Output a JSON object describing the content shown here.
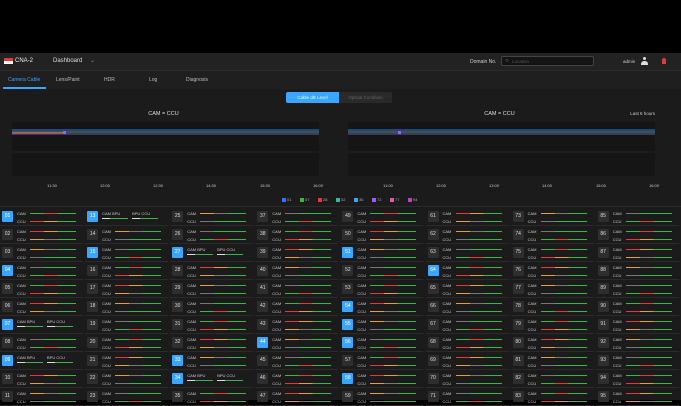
{
  "header": {
    "logo_text": "CNA",
    "app_title": "CNA-2",
    "section": "Dashboard",
    "domain_label": "Domain No.",
    "search_placeholder": "Location",
    "user": "admin",
    "colors": {
      "accent": "#3aa6ff",
      "brand": "#e23a3a"
    }
  },
  "tabs": [
    "Camera Cable",
    "Lens/Paint",
    "HDR",
    "Log",
    "Diagnosis"
  ],
  "active_tab": 0,
  "toggle": {
    "on": "Cable dB Level",
    "off": "Optical Condition"
  },
  "panels": [
    {
      "title": "CAM = CCU",
      "select": "",
      "x_ticks": [
        "11:30",
        "12:00",
        "12:30",
        "14:30",
        "15:30",
        "16:00"
      ]
    },
    {
      "title": "CAM = CCU",
      "select": "Last 6 hours",
      "x_ticks": [
        "11:00",
        "12:00",
        "13:00",
        "14:00",
        "15:00",
        "16:00"
      ]
    }
  ],
  "legend": [
    {
      "label": "01",
      "color": "#3a6dff"
    },
    {
      "label": "07",
      "color": "#3ab54a"
    },
    {
      "label": "28",
      "color": "#e23a3a"
    },
    {
      "label": "32",
      "color": "#3ab5a0"
    },
    {
      "label": "36",
      "color": "#3aa6ff"
    },
    {
      "label": "72",
      "color": "#9b5cff"
    },
    {
      "label": "77",
      "color": "#e05aa0"
    },
    {
      "label": "94",
      "color": "#c040c0"
    }
  ],
  "cam_label": "CAM",
  "ccu_label": "CCU",
  "bpu_cam_label": "CAM BPU",
  "bpu_ccu_label": "BPU CCU",
  "grid": {
    "highlight": [
      "01",
      "04",
      "07",
      "09",
      "13",
      "15",
      "27",
      "33",
      "34",
      "44",
      "51",
      "54",
      "55",
      "56",
      "58",
      "64"
    ],
    "bpu_cells": [
      "07",
      "09",
      "13",
      "27",
      "34"
    ],
    "columns": [
      [
        "01",
        "02",
        "03",
        "04",
        "05",
        "06",
        "07",
        "08",
        "09",
        "10",
        "11"
      ],
      [
        "13",
        "14",
        "15",
        "16",
        "17",
        "18",
        "19",
        "20",
        "21",
        "22",
        "23"
      ],
      [
        "25",
        "26",
        "27",
        "28",
        "29",
        "30",
        "31",
        "32",
        "33",
        "34",
        "35"
      ],
      [
        "37",
        "38",
        "39",
        "40",
        "41",
        "42",
        "43",
        "44",
        "45",
        "46",
        "47"
      ],
      [
        "49",
        "50",
        "51",
        "52",
        "53",
        "54",
        "55",
        "56",
        "57",
        "58",
        "59"
      ],
      [
        "61",
        "62",
        "63",
        "64",
        "65",
        "66",
        "67",
        "68",
        "69",
        "70",
        "71"
      ],
      [
        "73",
        "74",
        "75",
        "76",
        "77",
        "78",
        "79",
        "80",
        "81",
        "82",
        "83"
      ],
      [
        "85",
        "86",
        "87",
        "88",
        "89",
        "90",
        "91",
        "92",
        "93",
        "94",
        "95"
      ]
    ]
  }
}
